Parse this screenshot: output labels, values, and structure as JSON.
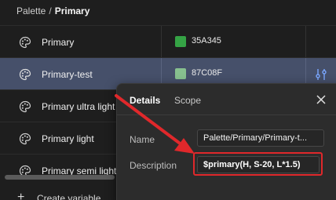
{
  "breadcrumb": {
    "parent": "Palette",
    "separator": "/",
    "current": "Primary"
  },
  "variables": [
    {
      "name": "Primary",
      "value": "35A345",
      "swatch": "#35A345",
      "selected": false
    },
    {
      "name": "Primary-test",
      "value": "87C08F",
      "swatch": "#87C08F",
      "selected": true
    },
    {
      "name": "Primary ultra light",
      "value": "",
      "swatch": "",
      "selected": false
    },
    {
      "name": "Primary light",
      "value": "",
      "swatch": "",
      "selected": false
    },
    {
      "name": "Primary semi light",
      "value": "",
      "swatch": "",
      "selected": false
    }
  ],
  "footer": {
    "create_label": "Create variable"
  },
  "dialog": {
    "tabs": [
      "Details",
      "Scope"
    ],
    "active_tab": "Details",
    "name_label": "Name",
    "name_value": "Palette/Primary/Primary-t...",
    "description_label": "Description",
    "description_value": "$primary(H, S-20, L*1.5)"
  },
  "colors": {
    "background": "#1e1e1e",
    "selected_row": "#46506a",
    "dialog_bg": "#2c2c2c",
    "annotation_red": "#e0282b",
    "accent_blue": "#7aa7ff"
  },
  "icons": {
    "row_icon": "palette-icon",
    "row_action": "variable-adjust-icon",
    "close": "close-icon",
    "create": "plus-icon"
  }
}
